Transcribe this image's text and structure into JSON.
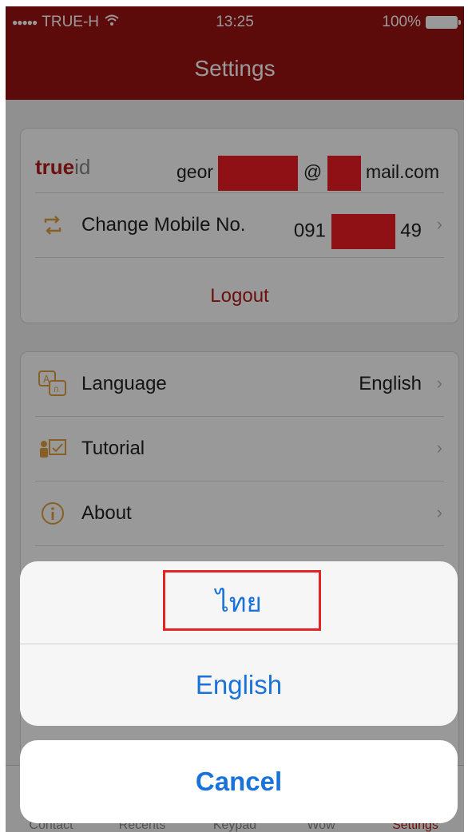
{
  "status_bar": {
    "carrier": "TRUE-H",
    "time": "13:25",
    "battery": "100%"
  },
  "nav": {
    "title": "Settings"
  },
  "account": {
    "brand_true": "true",
    "brand_id": "id",
    "email_prefix": "geor",
    "email_at": "@",
    "email_suffix": "mail.com",
    "change_mobile_label": "Change Mobile No.",
    "mobile_prefix": "091",
    "mobile_suffix": "49",
    "logout_label": "Logout"
  },
  "settings": {
    "language_label": "Language",
    "language_value": "English",
    "tutorial_label": "Tutorial",
    "about_label": "About"
  },
  "tabs": [
    "Contact",
    "Recents",
    "Keypad",
    "Wow",
    "Settings"
  ],
  "action_sheet": {
    "option_thai": "ไทย",
    "option_english": "English",
    "cancel_label": "Cancel"
  },
  "colors": {
    "header": "#9b1212",
    "accent_red": "#b51c1c",
    "ios_blue": "#1a73d9",
    "highlight": "#e32424"
  }
}
